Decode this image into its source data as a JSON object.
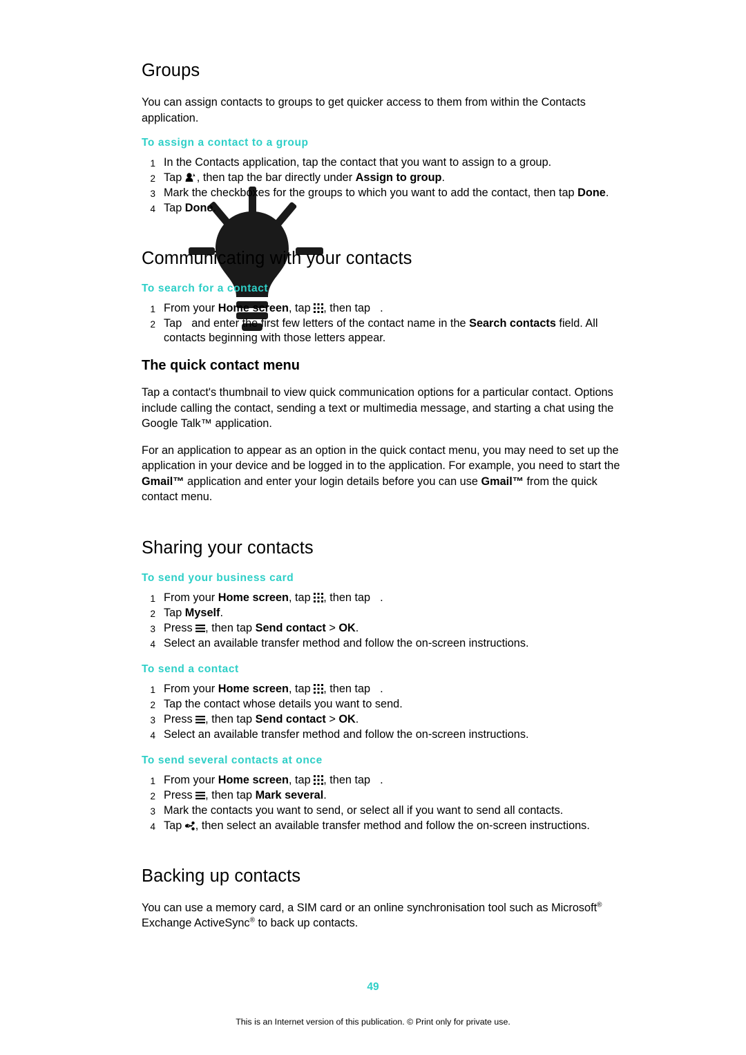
{
  "doc": {
    "page_number": "49",
    "footer": "This is an Internet version of this publication. © Print only for private use."
  },
  "sections": [
    {
      "id": "groups",
      "heading": "Groups",
      "paragraph": "You can assign contacts to groups to get quicker access to them from within the Contacts application.",
      "procedure": {
        "title": "To assign a contact to a group",
        "steps": [
          "In the Contacts application, tap the contact that you want to assign to a group.",
          "Tap  , then tap the bar directly under Assign to group.",
          "Mark the checkboxes for the groups to which you want to add the contact, then tap Done.",
          "Tap Done."
        ]
      }
    },
    {
      "id": "communicating",
      "heading": "Communicating with your contacts",
      "procedure": {
        "title": "To search for a contact",
        "steps": [
          "From your Home screen, tap  , then tap  .",
          "Tap   and enter the first few letters of the contact name in the Search contacts field. All contacts beginning with those letters appear."
        ]
      }
    },
    {
      "id": "quick-contact-menu",
      "heading": "The quick contact menu",
      "paragraph1": "Tap a contact's thumbnail to view quick communication options for a particular contact. Options include calling the contact, sending a text or multimedia message, and starting a chat using the Google Talk™ application.",
      "paragraph2": "For an application to appear as an option in the quick contact menu, you may need to set up the application in your device and be logged in to the application. For example, you need to start the Gmail™ application and enter your login details before you can use Gmail™ from the quick contact menu."
    },
    {
      "id": "sharing",
      "heading": "Sharing your contacts",
      "procedures": [
        {
          "title": "To send your business card",
          "steps": [
            "From your Home screen, tap  , then tap  .",
            "Tap Myself.",
            "Press  , then tap Send contact > OK.",
            "Select an available transfer method and follow the on-screen instructions."
          ]
        },
        {
          "title": "To send a contact",
          "steps": [
            "From your Home screen, tap  , then tap  .",
            "Tap the contact whose details you want to send.",
            "Press  , then tap Send contact > OK.",
            "Select an available transfer method and follow the on-screen instructions."
          ]
        },
        {
          "title": "To send several contacts at once",
          "steps": [
            "From your Home screen, tap  , then tap  .",
            "Press  , then tap Mark several.",
            "Mark the contacts you want to send, or select all if you want to send all contacts.",
            "Tap  , then select an available transfer method and follow the on-screen instructions."
          ]
        }
      ]
    },
    {
      "id": "backing-up",
      "heading": "Backing up contacts",
      "paragraph": "You can use a memory card, a SIM card or an online synchronisation tool such as Microsoft® Exchange ActiveSync® to back up contacts."
    }
  ],
  "text_fragments": {
    "groups_heading": "Groups",
    "groups_para": "You can assign contacts to groups to get quicker access to them from within the Contacts application.",
    "assign_title": "To assign a contact to a group",
    "assign_s1": "In the Contacts application, tap the contact that you want to assign to a group.",
    "assign_s2_a": "Tap",
    "assign_s2_b": ", then tap the bar directly under ",
    "assign_s2_bold": "Assign to group",
    "assign_s2_end": ".",
    "assign_s3_a": "Mark the checkboxes for the groups to which you want to add the contact, then tap ",
    "assign_s3_bold": "Done",
    "assign_s3_end": ".",
    "assign_s4_a": "Tap ",
    "assign_s4_bold": "Done",
    "assign_s4_end": ".",
    "comm_heading": "Communicating with your contacts",
    "search_title": "To search for a contact",
    "search_s1_a": "From your ",
    "search_s1_bold": "Home screen",
    "search_s1_b": ", tap",
    "search_s1_c": ", then tap",
    "search_s1_end": ".",
    "search_s2_a": "Tap",
    "search_s2_b": "and enter the first few letters of the contact name in the ",
    "search_s2_bold1": "Search",
    "search_s2_bold2": "contacts",
    "search_s2_c": " field. All contacts beginning with those letters appear.",
    "quick_heading": "The quick contact menu",
    "quick_p1": "Tap a contact's thumbnail to view quick communication options for a particular contact. Options include calling the contact, sending a text or multimedia message, and starting a chat using the Google Talk™ application.",
    "quick_p2_a": "For an application to appear as an option in the quick contact menu, you may need to set up the application in your device and be logged in to the application. For example, you need to start the ",
    "quick_p2_gmail1": "Gmail™",
    "quick_p2_b": " application and enter your login details before you can use ",
    "quick_p2_gmail2": "Gmail™",
    "quick_p2_c": " from the quick contact menu.",
    "sharing_heading": "Sharing your contacts",
    "bcard_title": "To send your business card",
    "bcard_s2_a": "Tap ",
    "bcard_s2_bold": "Myself",
    "bcard_s2_end": ".",
    "press_a": "Press",
    "press_b": ", then tap ",
    "send_contact_bold": "Send contact",
    "gt": " > ",
    "ok_bold": "OK",
    "dot": ".",
    "select_transfer": "Select an available transfer method and follow the on-screen instructions.",
    "sendc_title": "To send a contact",
    "sendc_s2": "Tap the contact whose details you want to send.",
    "sendmany_title": "To send several contacts at once",
    "sendmany_s2_a": "Press",
    "sendmany_s2_b": ", then tap ",
    "sendmany_s2_bold": "Mark several",
    "sendmany_s2_end": ".",
    "sendmany_s3": "Mark the contacts you want to send, or select all if you want to send all contacts.",
    "sendmany_s4_a": "Tap",
    "sendmany_s4_b": ", then select an available transfer method and follow the on-screen instructions.",
    "backup_heading": "Backing up contacts",
    "backup_p_a": "You can use a memory card, a SIM card or an online synchronisation tool such as Microsoft",
    "backup_p_b": " Exchange ActiveSync",
    "backup_p_c": " to back up contacts."
  },
  "colors": {
    "accent": "#2ecfc7",
    "text": "#000000",
    "page_bg": "#ffffff"
  }
}
